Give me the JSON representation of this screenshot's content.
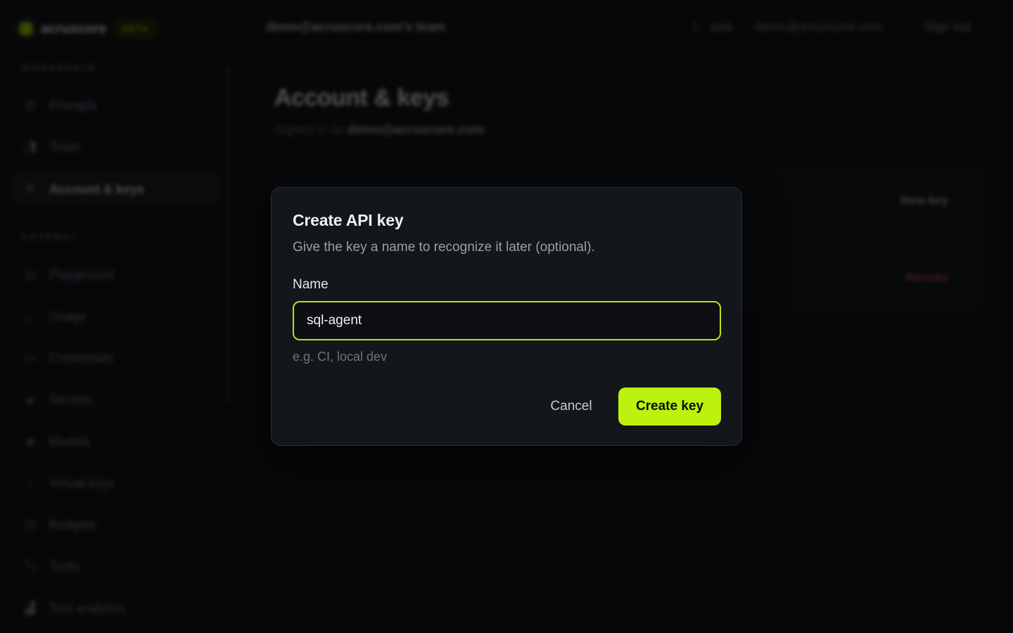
{
  "brand": {
    "name": "acruxcore",
    "badge": "BETA"
  },
  "sidebar": {
    "sections": [
      {
        "label": "WORKSPACE",
        "items": [
          {
            "label": "Prompts",
            "icon": "list-icon"
          },
          {
            "label": "Team",
            "icon": "users-icon"
          },
          {
            "label": "Account & keys",
            "icon": "settings-icon",
            "active": true
          }
        ]
      },
      {
        "label": "GATEWAY",
        "items": [
          {
            "label": "Playground",
            "icon": "playground-icon"
          },
          {
            "label": "Usage",
            "icon": "chart-icon"
          },
          {
            "label": "Credentials",
            "icon": "card-icon"
          },
          {
            "label": "Secrets",
            "icon": "lock-icon"
          },
          {
            "label": "Models",
            "icon": "cube-icon"
          },
          {
            "label": "Virtual keys",
            "icon": "key-icon"
          },
          {
            "label": "Budgets",
            "icon": "clock-icon"
          },
          {
            "label": "Tools",
            "icon": "wrench-icon"
          },
          {
            "label": "Tool analytics",
            "icon": "bar-chart-icon"
          }
        ]
      }
    ]
  },
  "topbar": {
    "team": "demo@acruxcore.com's team",
    "theme_label": "dark",
    "email": "demo@acruxcore.com",
    "signout": "Sign out"
  },
  "main": {
    "title": "Account & keys",
    "signed_in_prefix": "Signed in as",
    "signed_in_email": "demo@acruxcore.com",
    "new_key_label": "New key",
    "revoke_label": "Revoke"
  },
  "modal": {
    "title": "Create API key",
    "description": "Give the key a name to recognize it later (optional).",
    "field_label": "Name",
    "field_value": "sql-agent",
    "field_hint": "e.g. CI, local dev",
    "cancel_label": "Cancel",
    "create_label": "Create key"
  },
  "colors": {
    "accent": "#bdf20f",
    "danger": "#b0443a"
  }
}
